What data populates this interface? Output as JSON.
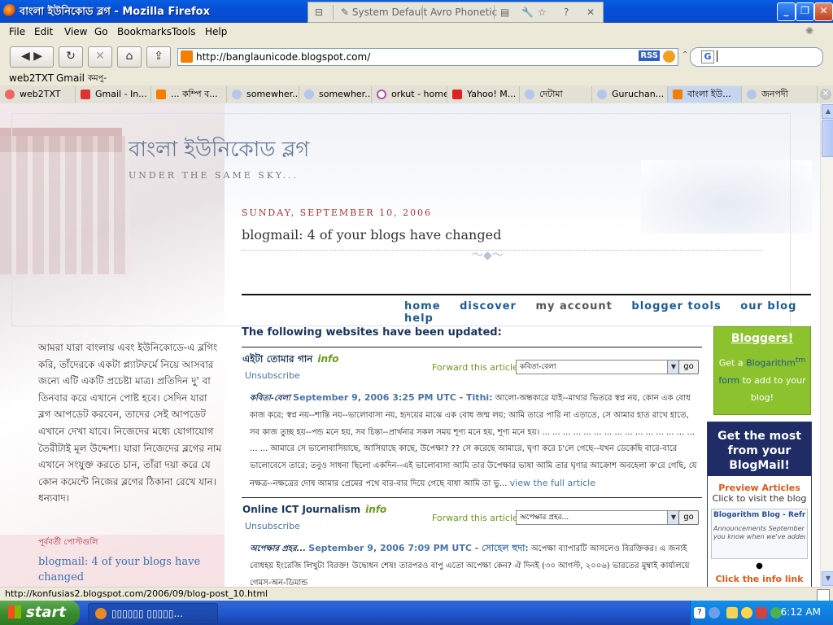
{
  "window": {
    "title": "বাংলা ইউনিকোড ব্লগ - Mozilla Firefox",
    "ime": {
      "mode": "System Default",
      "layout": "Avro Phonetic"
    }
  },
  "menu": [
    "File",
    "Edit",
    "View",
    "Go",
    "Bookmarks",
    "Tools",
    "Help"
  ],
  "address": {
    "url": "http://banglaunicode.blogspot.com/",
    "rss": "RSS"
  },
  "search": {
    "placeholder": "G"
  },
  "bookmarks": [
    "web2TXT",
    "Gmail",
    "কমপু-"
  ],
  "tabs": [
    {
      "label": "web2TXT",
      "icon": "web2txt-icon"
    },
    {
      "label": "Gmail - In...",
      "icon": "gmail-icon"
    },
    {
      "label": "... কম্পি ব...",
      "icon": "blogger-icon"
    },
    {
      "label": "somewher...",
      "icon": "globe-icon"
    },
    {
      "label": "somewher...",
      "icon": "globe-icon"
    },
    {
      "label": "orkut - home",
      "icon": "orkut-icon"
    },
    {
      "label": "Yahoo! M...",
      "icon": "yahoo-icon"
    },
    {
      "label": "দেটামা",
      "icon": "globe-icon"
    },
    {
      "label": "Guruchan...",
      "icon": "globe-icon"
    },
    {
      "label": "বাংলা ইউ...",
      "icon": "blogger-icon",
      "active": true
    },
    {
      "label": "জনপদী",
      "icon": "globe-icon"
    }
  ],
  "blog": {
    "title": "বাংলা ইউনিকোড ব্লগ",
    "tagline": "UNDER THE SAME SKY...",
    "date": "SUNDAY, SEPTEMBER 10, 2006",
    "post_title": "blogmail: 4 of your blogs have changed",
    "sidebar_text": "আমরা যারা বাংলায় এবং ইউনিকোডে-এ ব্লগিং করি, তাঁদেরকে একটা প্ল্যাটফর্মে নিয়ে আসবার জন্যে এটি একটি প্রচেষ্টা মাত্র। প্রতিদিন দু' বা তিনবার করে এখানে পোষ্ট হবে। সেদিন যারা ব্লগ আপডেট করবেন, তাদের সেই আপডেট এখানে দেখা যাবে। নিজেদের মধ্যে যোগাযোগ তৈরীটাই মূল উদ্দেশ্য। যারা নিজেদের ব্লগের নাম এখানে সংযুক্ত করতে চান, তাঁরা দয়া করে যে কোন কমেন্টে নিজের ব্লগের ঠিকানা রেখে যান। ধন্যবাদ।",
    "sidebar_heading": "পূর্ববর্তী পোস্টগুলি",
    "sidebar_link": "blogmail: 4 of your blogs have changed"
  },
  "blogmail": {
    "nav": [
      "home",
      "discover",
      "my account",
      "blogger tools",
      "our blog",
      "help"
    ],
    "heading": "The following websites have been updated:",
    "forward_label": "Forward this article",
    "go_label": "go",
    "unsubscribe": "Unsubscribe",
    "info": "info",
    "items": [
      {
        "title": "এইটা তোমার গান",
        "select": "কবিতা-বেলা",
        "tag": "কবিতা-বেলা",
        "meta": "September 9, 2006 3:25 PM UTC - Tithi:",
        "excerpt": "আলো-অন্ধকারে যাই--মাথার ভিতরে স্বপ্ন নয়, কোন এক বোধ কাজ করে; স্বপ্ন নয়--শান্তি নয়--ভালোবাসা নয়, হৃদয়ের মাঝে এক বোধ জন্ম লয়; আমি তারে পারি না এড়াতে, সে আমার হাত রাখে হাতে, সব কাজ তুচ্ছ হয়--পন্ড মনে হয়, সব চিন্তা--প্রার্থনার সকল সময় শূণ্য মনে হয়, শূণ্য মনে হয়। ... ... ... ... ... ... ... ... ... ... ... ... ... ... ... ... ... আমারে সে ভালোবাসিয়াছে, আসিয়াছে কাছে, উপেক্ষা? ?? সে করেছে আমারে, ঘৃণা করে চ'লে গেছে--যখন ডেকেছি বারে-বারে ভালোবেসে তারে; তবুও সাধনা ছিলো একদিন--এই ভালোবাসা আমি তার উপেক্ষার ভাষা আমি তার ঘৃণার আক্রোশ অবহেলা ক'রে গেছি, যে নক্ষত্র--নক্ষত্রের দোষ আমার প্রেমের পথে বার-বার দিয়ে গেছে বাধা আমি তা ভু...",
        "more": "view the full article"
      },
      {
        "title": "Online ICT Journalism",
        "select": "অপেক্ষার প্রহর...",
        "tag": "অপেক্ষার প্রহর...",
        "meta": "September 9, 2006 7:09 PM UTC - সোহেল হুদা:",
        "excerpt": "অপেক্ষা ব্যাপারটি আসলেও বিরক্তিকর। এ জন্যই বোধহয় ইংরেজি লিখুটা বিরক্ত! উদ্বোধন শেষ! তারপরও বাপু এতো অপেক্ষা কেন? ঐ দিনই (৩০ আগস্ট, ২০০৬) ভারতের মুম্বাই কার্যালয়ে গেমস-অন-ডিমান্ড",
        "more": ""
      }
    ]
  },
  "ads": {
    "bloggers": {
      "title": "Bloggers!",
      "pre": "Get a",
      "link1": "Blogarithm",
      "tm": "tm",
      "link2": "form",
      "post": "to add to your blog!"
    },
    "blogmail": {
      "heading": "Get the most from your BlogMail!",
      "preview": "Preview Articles",
      "caption": "Click to visit the blog",
      "box_title": "Blogarithm Blog - Refresh Refreshment",
      "box_sub": "Announcements  September",
      "box_sub2": "you know when we've added",
      "cta": "Click the info link"
    }
  },
  "status": "http://konfusias2.blogspot.com/2006/09/blog-post_10.html",
  "taskbar": {
    "start": "start",
    "item": "▯▯▯▯▯▯ ▯▯▯▯▯...",
    "clock": "6:12 AM"
  },
  "colors": {
    "accent": "#1c5c97",
    "green": "#8cc22d",
    "navy": "#1f2c66",
    "orange": "#e05a16"
  }
}
